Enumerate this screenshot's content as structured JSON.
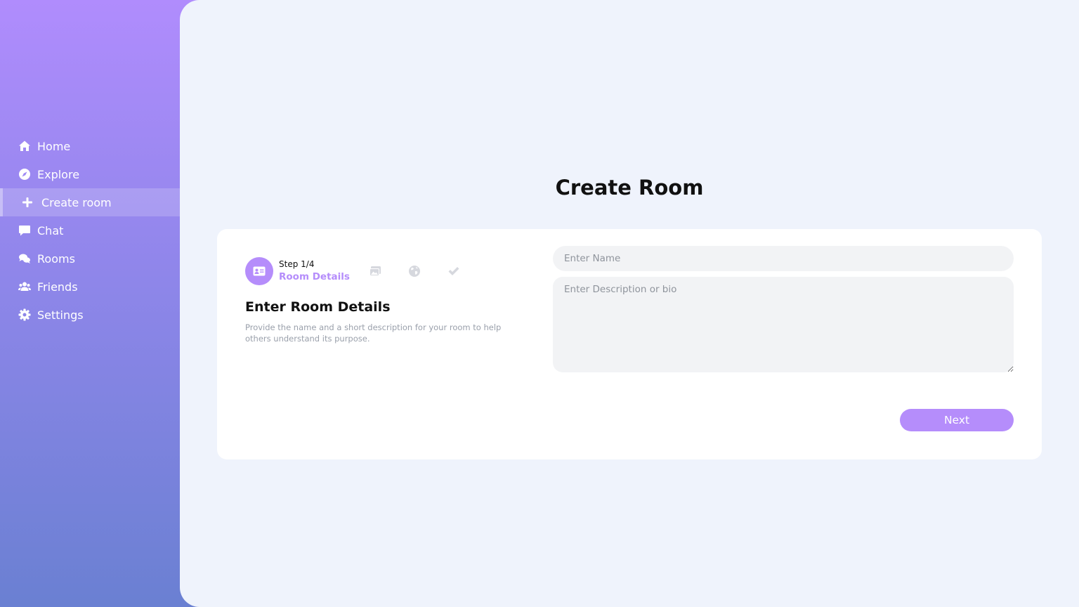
{
  "sidebar": {
    "items": [
      {
        "label": "Home",
        "icon": "home-icon"
      },
      {
        "label": "Explore",
        "icon": "compass-icon"
      },
      {
        "label": "Create room",
        "icon": "plus-icon",
        "active": true
      },
      {
        "label": "Chat",
        "icon": "chat-icon"
      },
      {
        "label": "Rooms",
        "icon": "comments-icon"
      },
      {
        "label": "Friends",
        "icon": "users-icon"
      },
      {
        "label": "Settings",
        "icon": "gear-icon"
      }
    ]
  },
  "main": {
    "title": "Create Room",
    "stepper": {
      "step_count": "Step 1/4",
      "step_name": "Room Details",
      "icons": [
        "id-card-icon",
        "images-icon",
        "globe-icon",
        "check-icon"
      ]
    },
    "details_title": "Enter Room Details",
    "details_description": "Provide the name and a short description for your room to help others understand its purpose.",
    "name_placeholder": "Enter Name",
    "name_value": "",
    "description_placeholder": "Enter Description or bio",
    "description_value": "",
    "next_label": "Next"
  },
  "colors": {
    "accent": "#b58dfb",
    "sidebar_gradient_top": "#b08cfd",
    "sidebar_gradient_bottom": "#6a80d2",
    "main_background": "#eff3fc"
  }
}
